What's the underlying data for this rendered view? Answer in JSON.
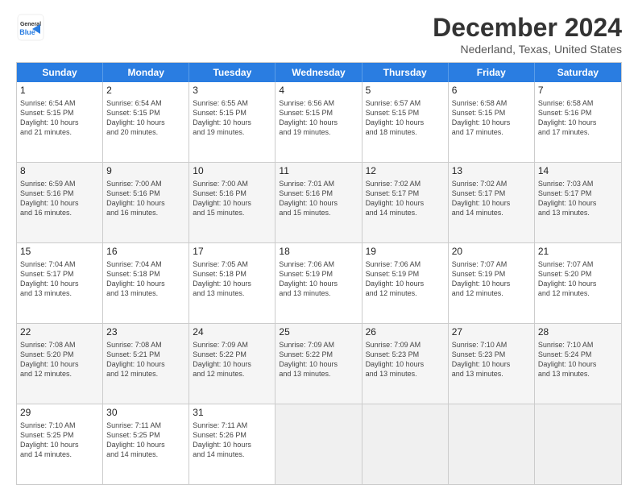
{
  "logo": {
    "line1": "General",
    "line2": "Blue"
  },
  "title": "December 2024",
  "location": "Nederland, Texas, United States",
  "days_of_week": [
    "Sunday",
    "Monday",
    "Tuesday",
    "Wednesday",
    "Thursday",
    "Friday",
    "Saturday"
  ],
  "rows": [
    [
      {
        "num": "1",
        "lines": [
          "Sunrise: 6:54 AM",
          "Sunset: 5:15 PM",
          "Daylight: 10 hours",
          "and 21 minutes."
        ]
      },
      {
        "num": "2",
        "lines": [
          "Sunrise: 6:54 AM",
          "Sunset: 5:15 PM",
          "Daylight: 10 hours",
          "and 20 minutes."
        ]
      },
      {
        "num": "3",
        "lines": [
          "Sunrise: 6:55 AM",
          "Sunset: 5:15 PM",
          "Daylight: 10 hours",
          "and 19 minutes."
        ]
      },
      {
        "num": "4",
        "lines": [
          "Sunrise: 6:56 AM",
          "Sunset: 5:15 PM",
          "Daylight: 10 hours",
          "and 19 minutes."
        ]
      },
      {
        "num": "5",
        "lines": [
          "Sunrise: 6:57 AM",
          "Sunset: 5:15 PM",
          "Daylight: 10 hours",
          "and 18 minutes."
        ]
      },
      {
        "num": "6",
        "lines": [
          "Sunrise: 6:58 AM",
          "Sunset: 5:15 PM",
          "Daylight: 10 hours",
          "and 17 minutes."
        ]
      },
      {
        "num": "7",
        "lines": [
          "Sunrise: 6:58 AM",
          "Sunset: 5:16 PM",
          "Daylight: 10 hours",
          "and 17 minutes."
        ]
      }
    ],
    [
      {
        "num": "8",
        "lines": [
          "Sunrise: 6:59 AM",
          "Sunset: 5:16 PM",
          "Daylight: 10 hours",
          "and 16 minutes."
        ]
      },
      {
        "num": "9",
        "lines": [
          "Sunrise: 7:00 AM",
          "Sunset: 5:16 PM",
          "Daylight: 10 hours",
          "and 16 minutes."
        ]
      },
      {
        "num": "10",
        "lines": [
          "Sunrise: 7:00 AM",
          "Sunset: 5:16 PM",
          "Daylight: 10 hours",
          "and 15 minutes."
        ]
      },
      {
        "num": "11",
        "lines": [
          "Sunrise: 7:01 AM",
          "Sunset: 5:16 PM",
          "Daylight: 10 hours",
          "and 15 minutes."
        ]
      },
      {
        "num": "12",
        "lines": [
          "Sunrise: 7:02 AM",
          "Sunset: 5:17 PM",
          "Daylight: 10 hours",
          "and 14 minutes."
        ]
      },
      {
        "num": "13",
        "lines": [
          "Sunrise: 7:02 AM",
          "Sunset: 5:17 PM",
          "Daylight: 10 hours",
          "and 14 minutes."
        ]
      },
      {
        "num": "14",
        "lines": [
          "Sunrise: 7:03 AM",
          "Sunset: 5:17 PM",
          "Daylight: 10 hours",
          "and 13 minutes."
        ]
      }
    ],
    [
      {
        "num": "15",
        "lines": [
          "Sunrise: 7:04 AM",
          "Sunset: 5:17 PM",
          "Daylight: 10 hours",
          "and 13 minutes."
        ]
      },
      {
        "num": "16",
        "lines": [
          "Sunrise: 7:04 AM",
          "Sunset: 5:18 PM",
          "Daylight: 10 hours",
          "and 13 minutes."
        ]
      },
      {
        "num": "17",
        "lines": [
          "Sunrise: 7:05 AM",
          "Sunset: 5:18 PM",
          "Daylight: 10 hours",
          "and 13 minutes."
        ]
      },
      {
        "num": "18",
        "lines": [
          "Sunrise: 7:06 AM",
          "Sunset: 5:19 PM",
          "Daylight: 10 hours",
          "and 13 minutes."
        ]
      },
      {
        "num": "19",
        "lines": [
          "Sunrise: 7:06 AM",
          "Sunset: 5:19 PM",
          "Daylight: 10 hours",
          "and 12 minutes."
        ]
      },
      {
        "num": "20",
        "lines": [
          "Sunrise: 7:07 AM",
          "Sunset: 5:19 PM",
          "Daylight: 10 hours",
          "and 12 minutes."
        ]
      },
      {
        "num": "21",
        "lines": [
          "Sunrise: 7:07 AM",
          "Sunset: 5:20 PM",
          "Daylight: 10 hours",
          "and 12 minutes."
        ]
      }
    ],
    [
      {
        "num": "22",
        "lines": [
          "Sunrise: 7:08 AM",
          "Sunset: 5:20 PM",
          "Daylight: 10 hours",
          "and 12 minutes."
        ]
      },
      {
        "num": "23",
        "lines": [
          "Sunrise: 7:08 AM",
          "Sunset: 5:21 PM",
          "Daylight: 10 hours",
          "and 12 minutes."
        ]
      },
      {
        "num": "24",
        "lines": [
          "Sunrise: 7:09 AM",
          "Sunset: 5:22 PM",
          "Daylight: 10 hours",
          "and 12 minutes."
        ]
      },
      {
        "num": "25",
        "lines": [
          "Sunrise: 7:09 AM",
          "Sunset: 5:22 PM",
          "Daylight: 10 hours",
          "and 13 minutes."
        ]
      },
      {
        "num": "26",
        "lines": [
          "Sunrise: 7:09 AM",
          "Sunset: 5:23 PM",
          "Daylight: 10 hours",
          "and 13 minutes."
        ]
      },
      {
        "num": "27",
        "lines": [
          "Sunrise: 7:10 AM",
          "Sunset: 5:23 PM",
          "Daylight: 10 hours",
          "and 13 minutes."
        ]
      },
      {
        "num": "28",
        "lines": [
          "Sunrise: 7:10 AM",
          "Sunset: 5:24 PM",
          "Daylight: 10 hours",
          "and 13 minutes."
        ]
      }
    ],
    [
      {
        "num": "29",
        "lines": [
          "Sunrise: 7:10 AM",
          "Sunset: 5:25 PM",
          "Daylight: 10 hours",
          "and 14 minutes."
        ]
      },
      {
        "num": "30",
        "lines": [
          "Sunrise: 7:11 AM",
          "Sunset: 5:25 PM",
          "Daylight: 10 hours",
          "and 14 minutes."
        ]
      },
      {
        "num": "31",
        "lines": [
          "Sunrise: 7:11 AM",
          "Sunset: 5:26 PM",
          "Daylight: 10 hours",
          "and 14 minutes."
        ]
      },
      {
        "num": "",
        "lines": []
      },
      {
        "num": "",
        "lines": []
      },
      {
        "num": "",
        "lines": []
      },
      {
        "num": "",
        "lines": []
      }
    ]
  ]
}
